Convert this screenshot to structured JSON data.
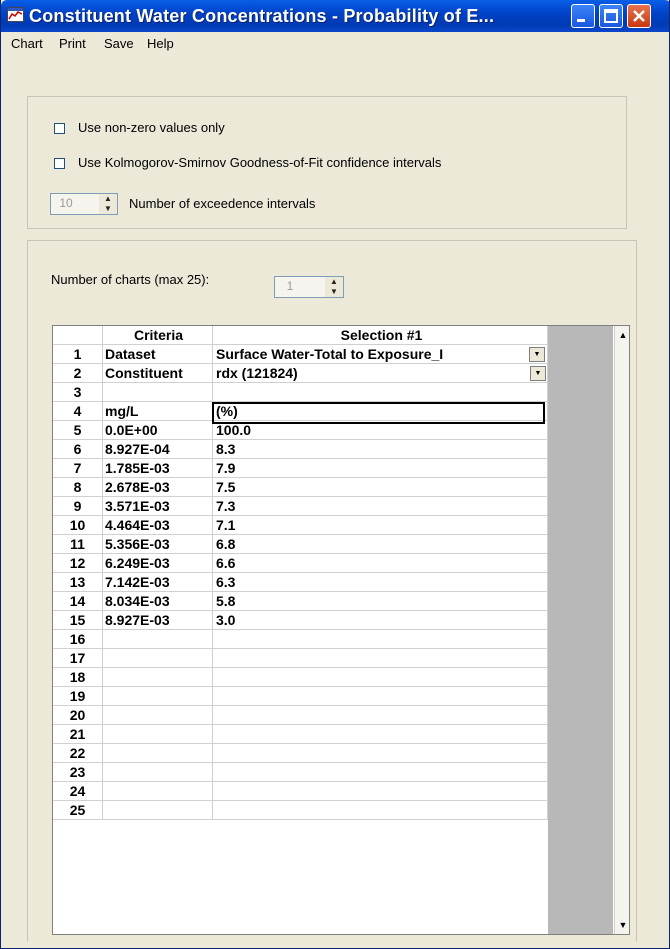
{
  "window": {
    "title": "Constituent Water Concentrations - Probability of E..."
  },
  "menu": [
    "Chart",
    "Print",
    "Save",
    "Help"
  ],
  "options": {
    "nonzero_label": "Use non-zero values only",
    "ks_label": "Use Kolmogorov-Smirnov Goodness-of-Fit confidence intervals",
    "intervals_value": "10",
    "intervals_label": "Number of exceedence intervals"
  },
  "charts": {
    "label": "Number of charts (max 25):",
    "value": "1"
  },
  "grid": {
    "headers": [
      "",
      "Criteria",
      "Selection #1"
    ],
    "rows": [
      {
        "num": "1",
        "criteria": "Dataset",
        "selection": "Surface Water-Total to Exposure_I"
      },
      {
        "num": "2",
        "criteria": "Constituent",
        "selection": "rdx (121824)"
      },
      {
        "num": "3",
        "criteria": "",
        "selection": ""
      },
      {
        "num": "4",
        "criteria": "mg/L",
        "selection": "(%)"
      },
      {
        "num": "5",
        "criteria": "0.0E+00",
        "selection": "100.0"
      },
      {
        "num": "6",
        "criteria": "8.927E-04",
        "selection": "8.3"
      },
      {
        "num": "7",
        "criteria": "1.785E-03",
        "selection": "7.9"
      },
      {
        "num": "8",
        "criteria": "2.678E-03",
        "selection": "7.5"
      },
      {
        "num": "9",
        "criteria": "3.571E-03",
        "selection": "7.3"
      },
      {
        "num": "10",
        "criteria": "4.464E-03",
        "selection": "7.1"
      },
      {
        "num": "11",
        "criteria": "5.356E-03",
        "selection": "6.8"
      },
      {
        "num": "12",
        "criteria": "6.249E-03",
        "selection": "6.6"
      },
      {
        "num": "13",
        "criteria": "7.142E-03",
        "selection": "6.3"
      },
      {
        "num": "14",
        "criteria": "8.034E-03",
        "selection": "5.8"
      },
      {
        "num": "15",
        "criteria": "8.927E-03",
        "selection": "3.0"
      },
      {
        "num": "16",
        "criteria": "",
        "selection": ""
      },
      {
        "num": "17",
        "criteria": "",
        "selection": ""
      },
      {
        "num": "18",
        "criteria": "",
        "selection": ""
      },
      {
        "num": "19",
        "criteria": "",
        "selection": ""
      },
      {
        "num": "20",
        "criteria": "",
        "selection": ""
      },
      {
        "num": "21",
        "criteria": "",
        "selection": ""
      },
      {
        "num": "22",
        "criteria": "",
        "selection": ""
      },
      {
        "num": "23",
        "criteria": "",
        "selection": ""
      },
      {
        "num": "24",
        "criteria": "",
        "selection": ""
      },
      {
        "num": "25",
        "criteria": "",
        "selection": ""
      }
    ]
  }
}
